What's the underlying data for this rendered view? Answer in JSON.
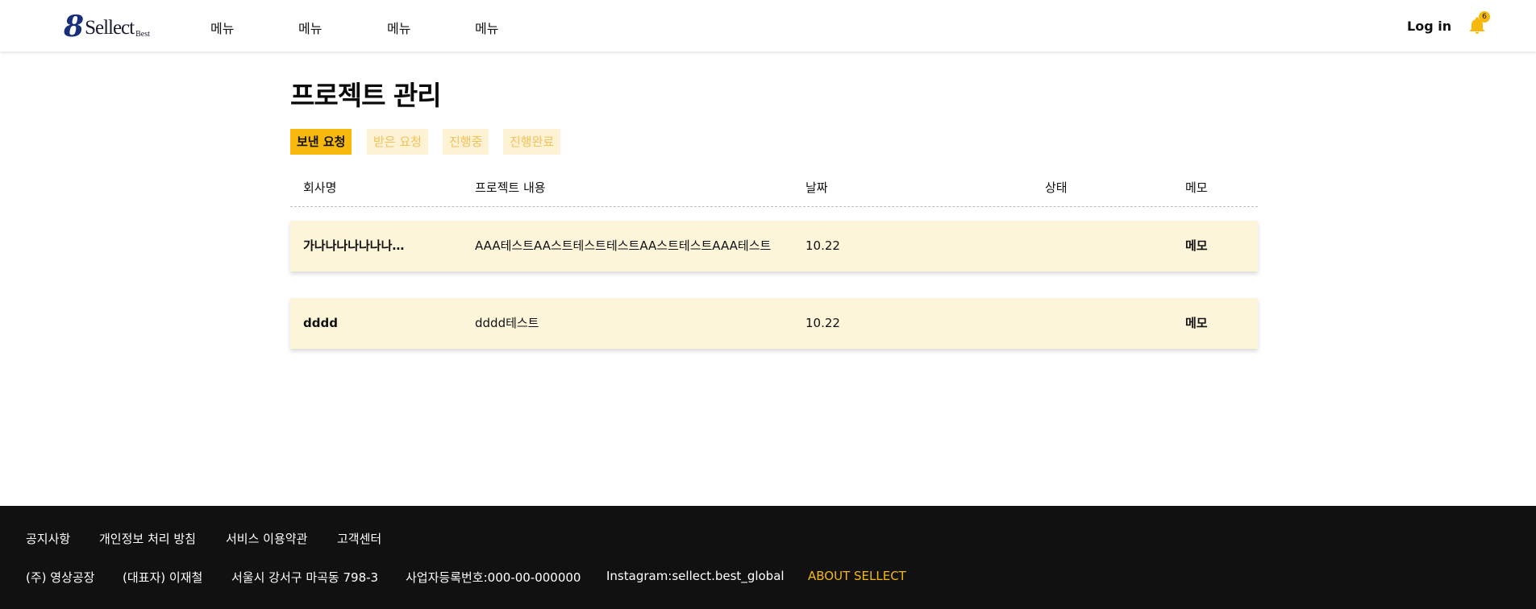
{
  "header": {
    "logo": {
      "mark": "8",
      "text": "Sellect",
      "sub": "Best"
    },
    "nav": [
      "메뉴",
      "메뉴",
      "메뉴",
      "메뉴"
    ],
    "login_label": "Log in",
    "notification_count": "6"
  },
  "main": {
    "title": "프로젝트 관리",
    "tabs": [
      {
        "label": "보낸 요청",
        "active": true
      },
      {
        "label": "받은 요청",
        "active": false
      },
      {
        "label": "진행중",
        "active": false
      },
      {
        "label": "진행완료",
        "active": false
      }
    ],
    "columns": [
      "회사명",
      "프로젝트 내용",
      "날짜",
      "상태",
      "메모"
    ],
    "rows": [
      {
        "company": "가나나나나나나나…",
        "content": "AAA테스트AA스트테스트테스트AA스트테스트AAA테스트",
        "date": "10.22",
        "status": "",
        "memo": "메모"
      },
      {
        "company": "dddd",
        "content": "dddd테스트",
        "date": "10.22",
        "status": "",
        "memo": "메모"
      }
    ]
  },
  "footer": {
    "links": [
      "공지사항",
      "개인정보 처리 방침",
      "서비스 이용약관",
      "고객센터"
    ],
    "info": [
      "(주) 영상공장",
      "(대표자) 이재철",
      "서울시 강서구 마곡동 798-3",
      "사업자등록번호:000-00-000000",
      "Instagram:sellect.best_global"
    ],
    "about": "ABOUT SELLECT"
  },
  "colors": {
    "accent": "#f8b90c",
    "row_bg": "#fdf5da",
    "footer_bg": "#111111",
    "logo_blue": "#1a2f7a"
  },
  "icons": {
    "bell": "bell-icon"
  }
}
